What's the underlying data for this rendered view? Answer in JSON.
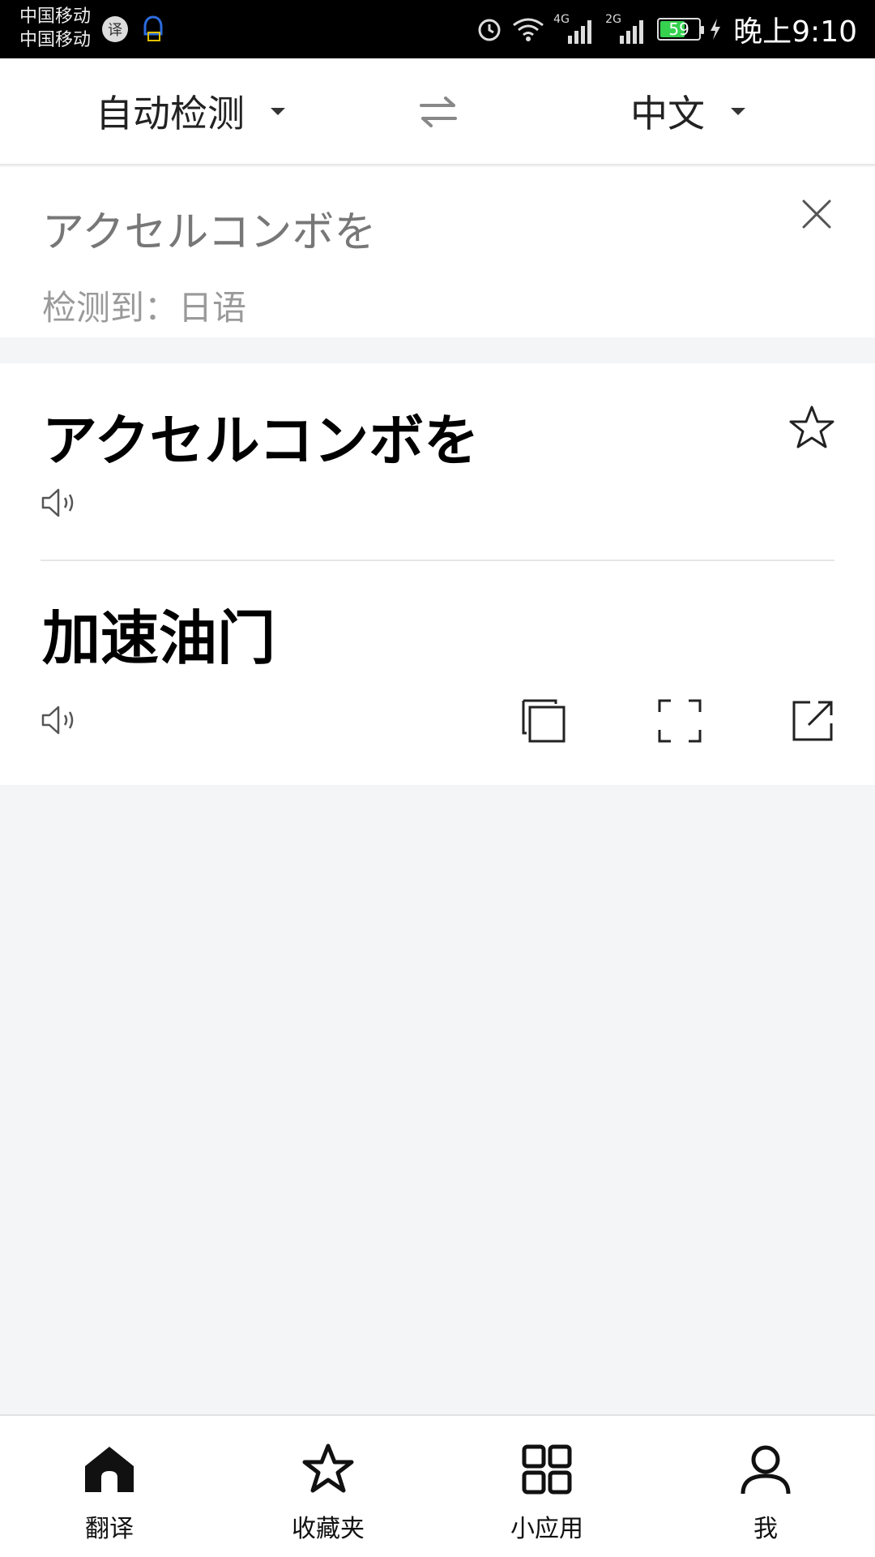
{
  "status_bar": {
    "carrier_1": "中国移动",
    "carrier_2": "中国移动",
    "network_1": "4G",
    "network_2": "2G",
    "battery": "59",
    "time": "晚上9:10"
  },
  "lang_bar": {
    "source_lang": "自动检测",
    "target_lang": "中文",
    "swap_icon": "swap-icon"
  },
  "input": {
    "text": "アクセルコンボを",
    "detected": "检测到：日语"
  },
  "result": {
    "source_text": "アクセルコンボを",
    "translation": "加速油门"
  },
  "nav": {
    "items": [
      {
        "label": "翻译",
        "icon": "home-icon"
      },
      {
        "label": "收藏夹",
        "icon": "star-icon"
      },
      {
        "label": "小应用",
        "icon": "grid-icon"
      },
      {
        "label": "我",
        "icon": "user-icon"
      }
    ]
  },
  "colors": {
    "background": "#f4f5f7",
    "card": "#ffffff",
    "battery_green": "#35d14f"
  }
}
